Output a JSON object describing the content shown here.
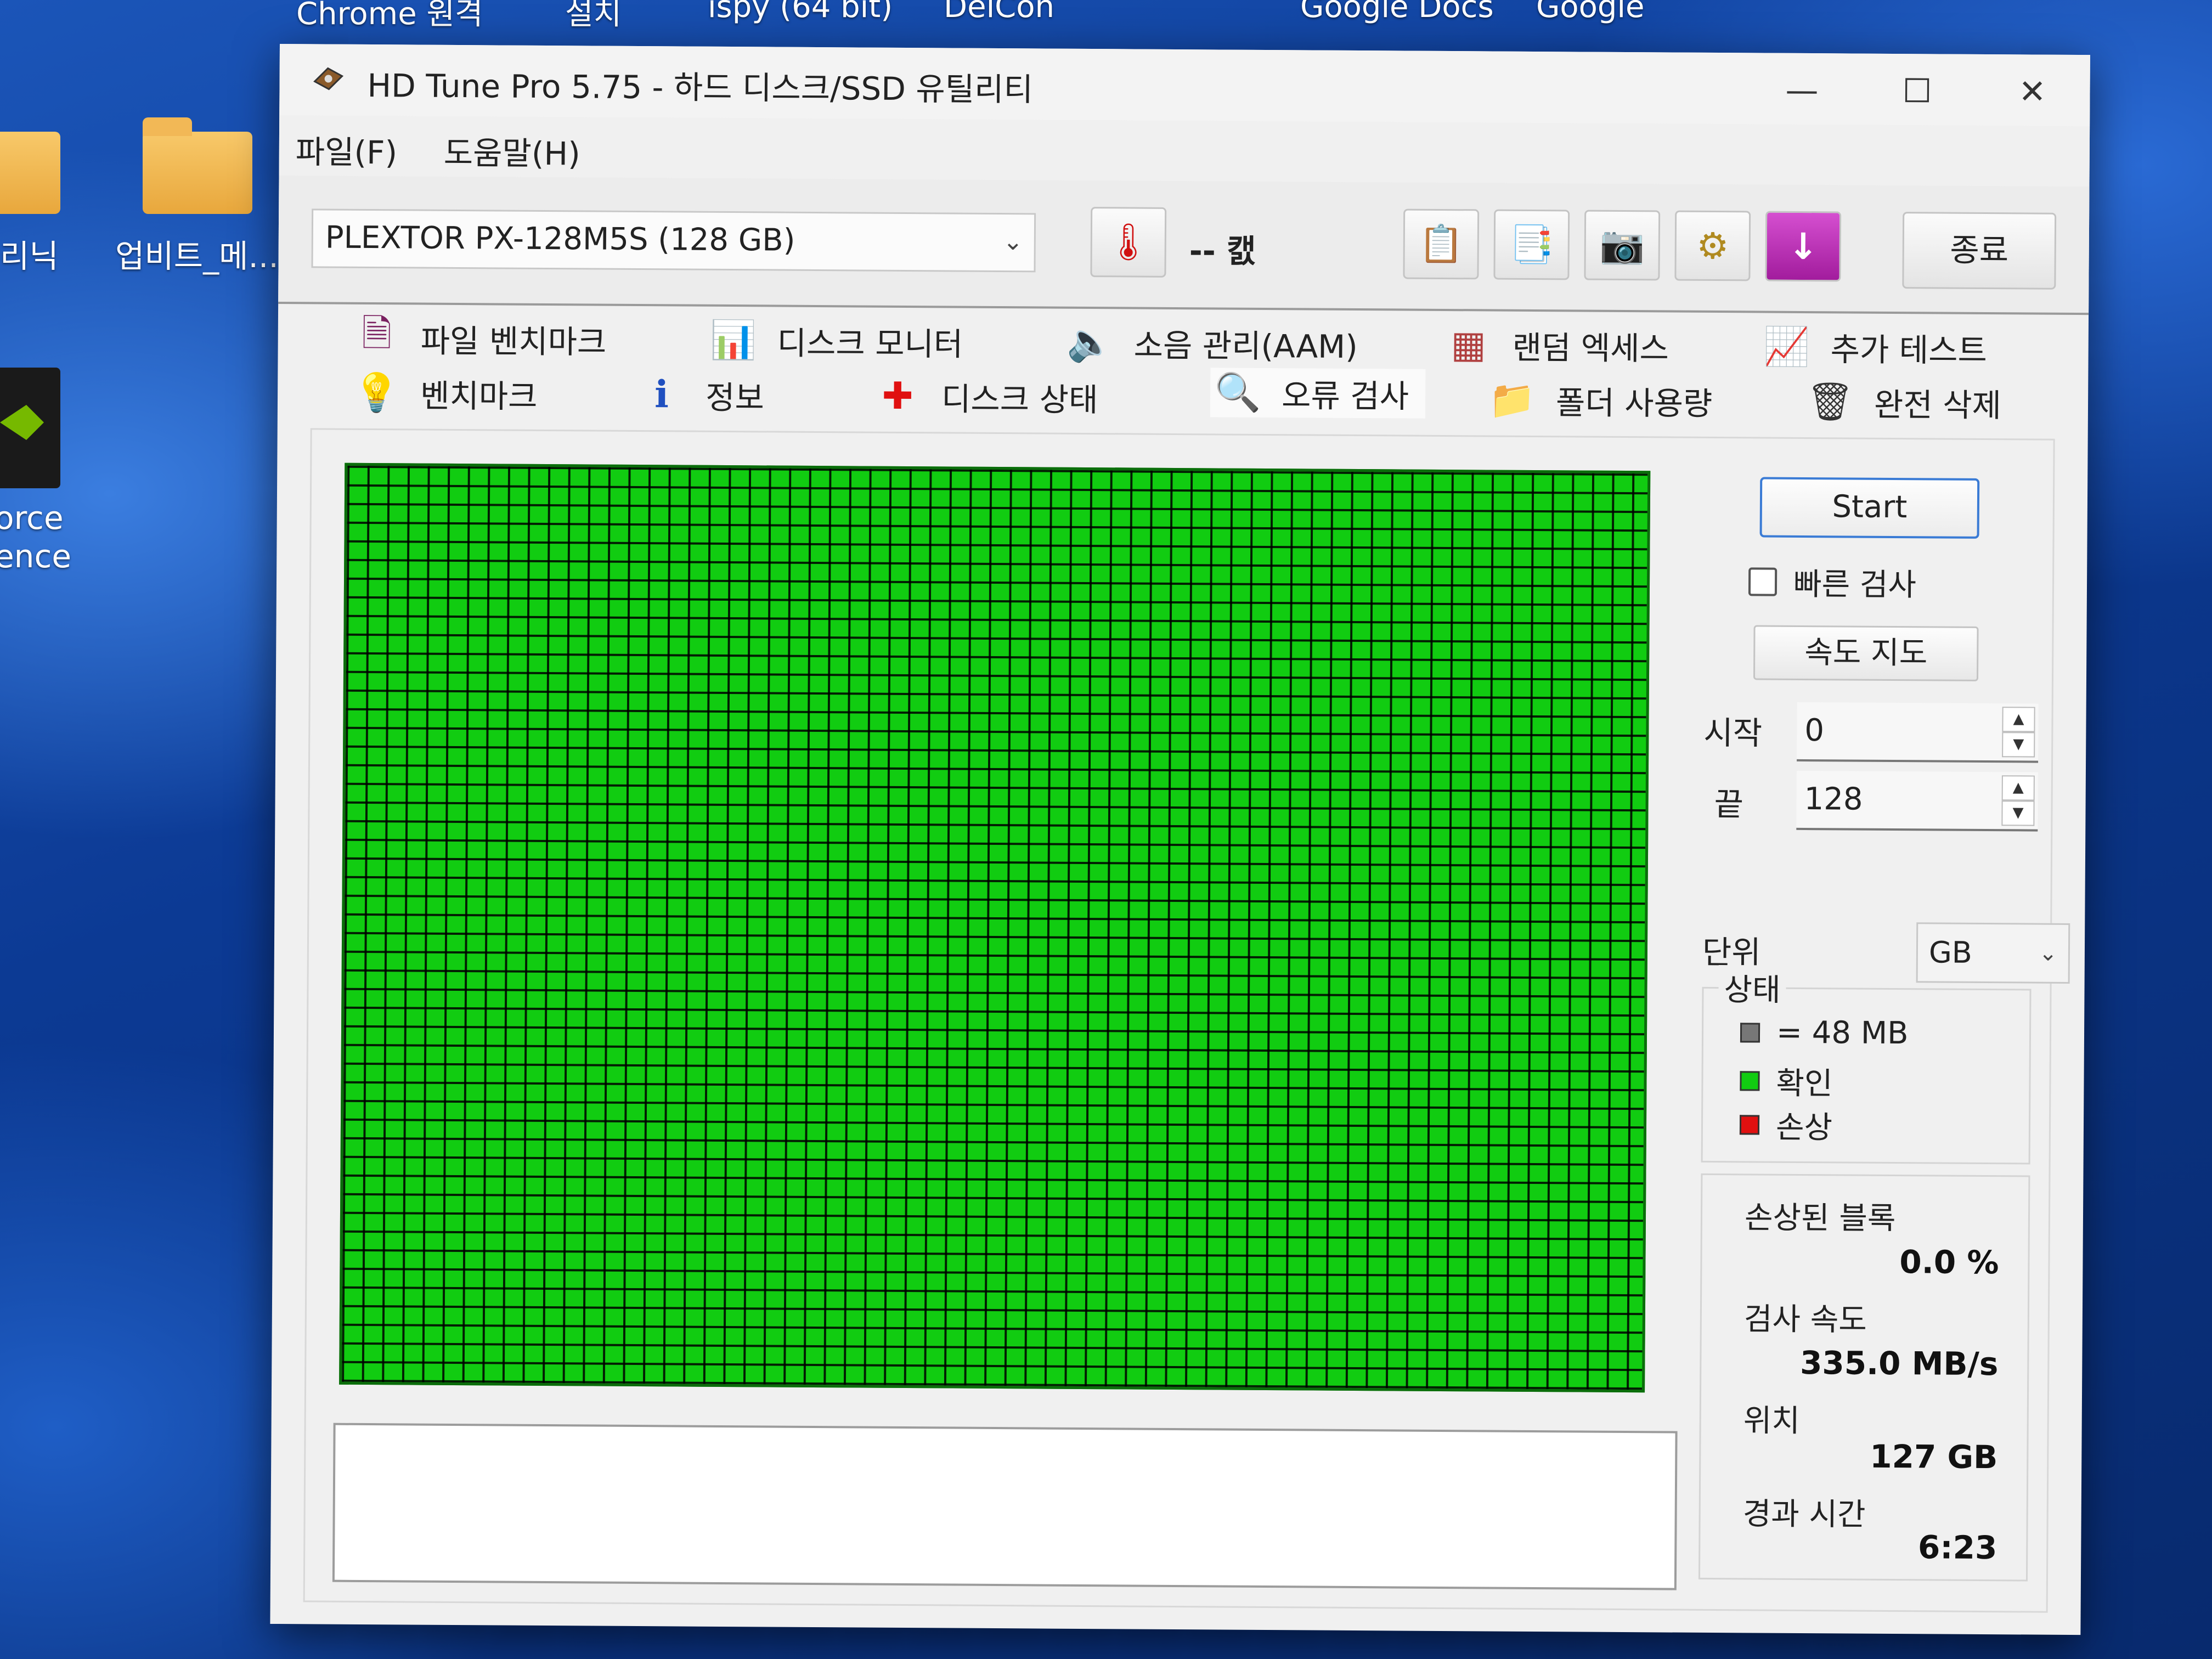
{
  "desktop": {
    "top_labels": [
      "Chrome 원격",
      "설치",
      "ispy (64 bit)",
      "DelCon",
      "Google Docs",
      "Google"
    ],
    "icons": [
      {
        "label": "리닉"
      },
      {
        "label": "업비트_메..."
      },
      {
        "label_line1": "orce",
        "label_line2": "ence"
      }
    ]
  },
  "window": {
    "title": "HD Tune Pro 5.75 - 하드 디스크/SSD 유틸리티",
    "controls": {
      "minimize": "—",
      "maximize": "☐",
      "close": "✕"
    }
  },
  "menu": {
    "file": "파일(F)",
    "help": "도움말(H)"
  },
  "toolbar": {
    "drive": "PLEXTOR PX-128M5S (128 GB)",
    "temperature": "-- 캜",
    "exit_label": "종료",
    "icons": [
      "copy-icon",
      "copy-info-icon",
      "camera-icon",
      "settings-icon",
      "download-icon"
    ]
  },
  "tabs": {
    "row1": [
      "파일 벤치마크",
      "디스크 모니터",
      "소음 관리(AAM)",
      "랜덤 엑세스",
      "추가 테스트"
    ],
    "row2": [
      "벤치마크",
      "정보",
      "디스크 상태",
      "오류 검사",
      "폴더 사용량",
      "완전 삭제"
    ],
    "active": "오류 검사"
  },
  "error_scan": {
    "start_label": "Start",
    "quick_scan_label": "빠른 검사",
    "quick_scan_checked": false,
    "speed_map_label": "속도 지도",
    "start_field_label": "시작",
    "start_value": "0",
    "end_field_label": "끝",
    "end_value": "128",
    "unit_label": "단위",
    "unit_value": "GB",
    "legend_title": "상태",
    "legend": [
      {
        "text": "= 48 MB",
        "color": "#777777"
      },
      {
        "text": "확인",
        "color": "#11cc11"
      },
      {
        "text": "손상",
        "color": "#e01010"
      }
    ],
    "stats": {
      "damaged_label": "손상된 블록",
      "damaged_value": "0.0 %",
      "speed_label": "검사 속도",
      "speed_value": "335.0 MB/s",
      "position_label": "위치",
      "position_value": "127 GB",
      "elapsed_label": "경과 시간",
      "elapsed_value": "6:23"
    },
    "grid_color": "#11cc11"
  }
}
